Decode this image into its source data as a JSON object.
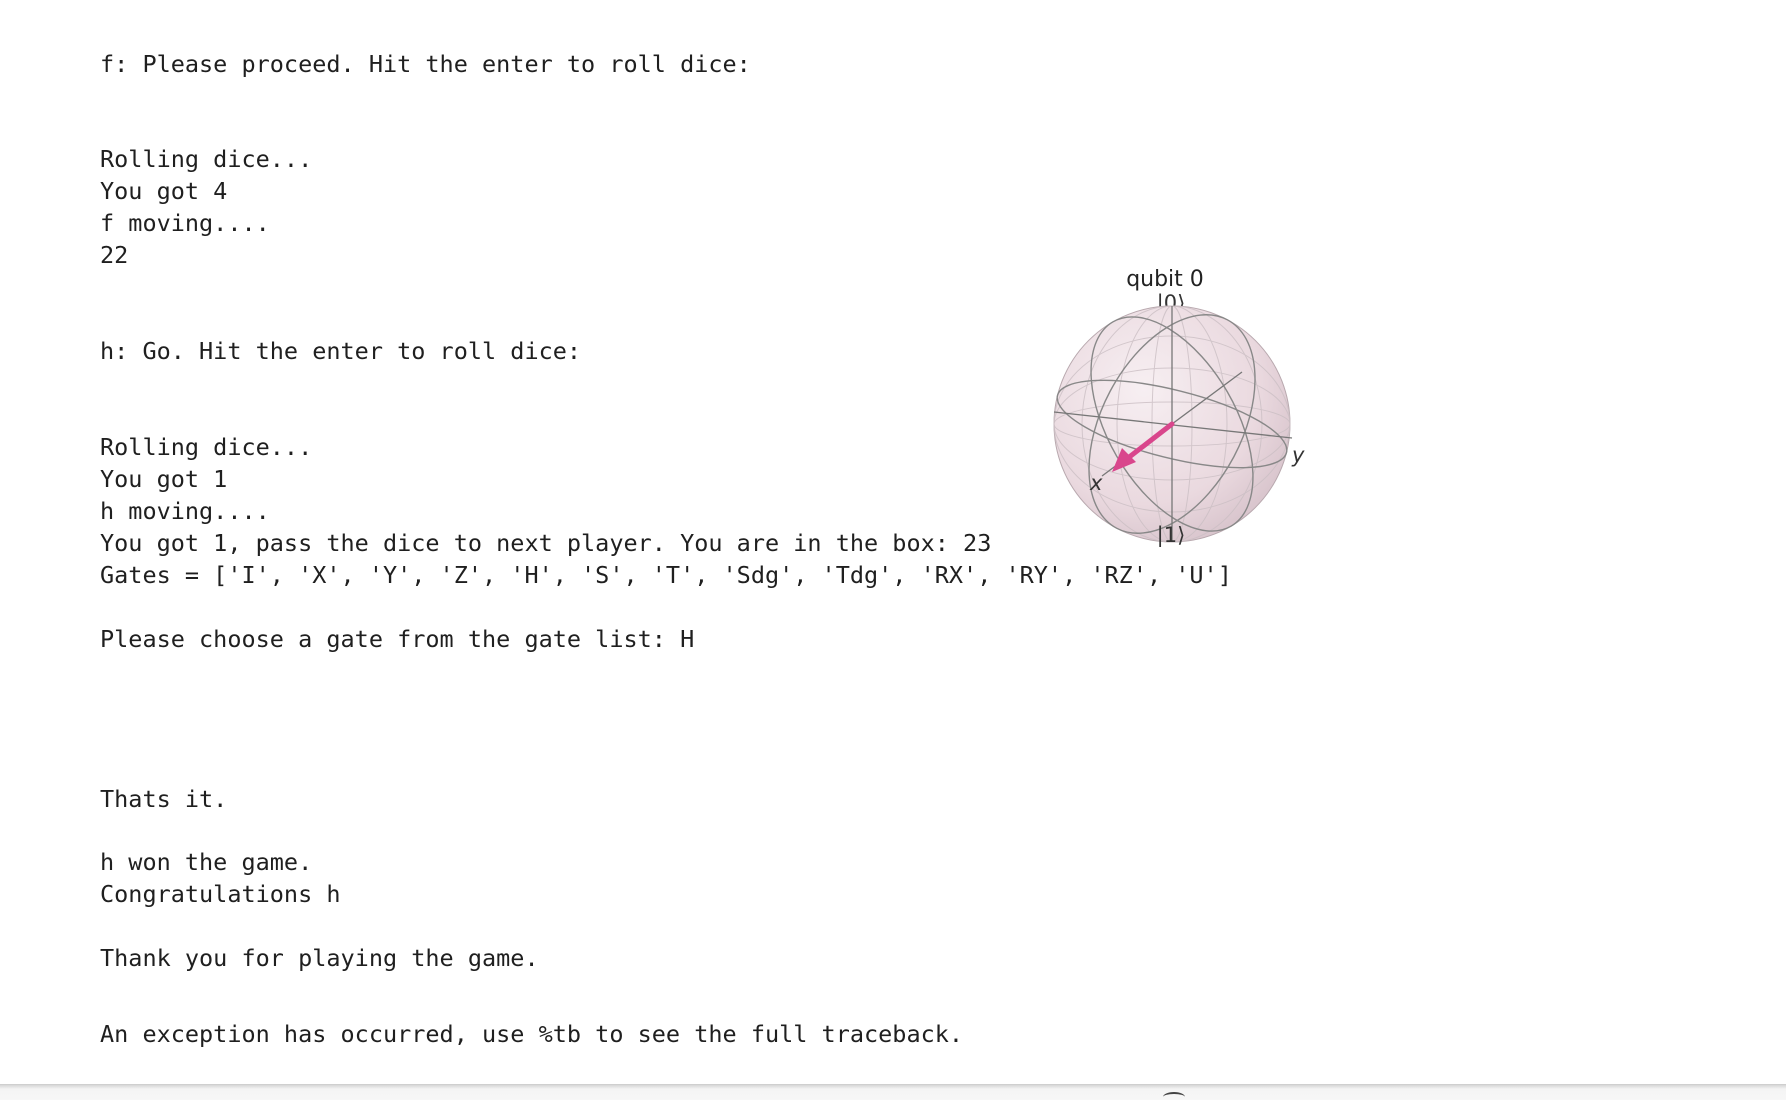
{
  "output": {
    "f_prompt": "f: Please proceed. Hit the enter to roll dice:",
    "f_roll": [
      "Rolling dice...",
      "You got 4",
      "f moving....",
      "22"
    ],
    "h_prompt": "h: Go. Hit the enter to roll dice:",
    "h_roll": [
      "Rolling dice...",
      "You got 1",
      "h moving....",
      "You got 1, pass the dice to next player. You are in the box: 23",
      "Gates = ['I', 'X', 'Y', 'Z', 'H', 'S', 'T', 'Sdg', 'Tdg', 'RX', 'RY', 'RZ', 'U']"
    ],
    "gate_prompt": "Please choose a gate from the gate list: H",
    "thats_it": "Thats it.",
    "won": [
      "h won the game.",
      "Congratulations h"
    ],
    "thanks": "Thank you for playing the game.",
    "exception": "An exception has occurred, use %tb to see the full traceback."
  },
  "bloch": {
    "title": "qubit 0",
    "ket0": "|0⟩",
    "ket1": "|1⟩",
    "x_label": "x",
    "y_label": "y",
    "vector_color": "#d9468c",
    "sphere_color": "#ead9df"
  }
}
